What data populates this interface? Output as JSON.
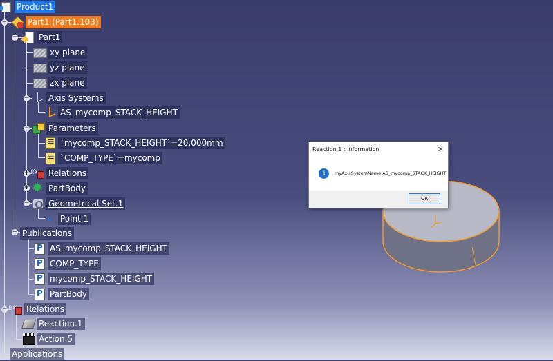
{
  "tree": {
    "product": "Product1",
    "part_instance": "Part1 (Part1.103)",
    "part": "Part1",
    "planes": [
      "xy plane",
      "yz plane",
      "zx plane"
    ],
    "axis_systems": "Axis Systems",
    "axis_system": "AS_mycomp_STACK_HEIGHT",
    "parameters": "Parameters",
    "param_items": [
      "`mycomp_STACK_HEIGHT`=20.000mm",
      "`COMP_TYPE`=mycomp"
    ],
    "relations_part": "Relations",
    "partbody": "PartBody",
    "geo_set": "Geometrical Set.1",
    "point": "Point.1",
    "publications": "Publications",
    "pub_items": [
      "AS_mycomp_STACK_HEIGHT",
      "COMP_TYPE",
      "mycomp_STACK_HEIGHT",
      "PartBody"
    ],
    "relations_product": "Relations",
    "reaction": "Reaction.1",
    "action": "Action.5",
    "applications": "Applications"
  },
  "dialog": {
    "title": "Reaction.1 : Information",
    "close_glyph": "✕",
    "info_glyph": "i",
    "message": "myAxisSystemName:AS_mycomp_STACK_HEIGHT",
    "ok_label": "OK"
  },
  "colors": {
    "background_top": "#3a3d6b",
    "selection_blue": "#1e78e6",
    "highlight_orange": "#f07c1e",
    "model_edge": "#f59a27"
  }
}
